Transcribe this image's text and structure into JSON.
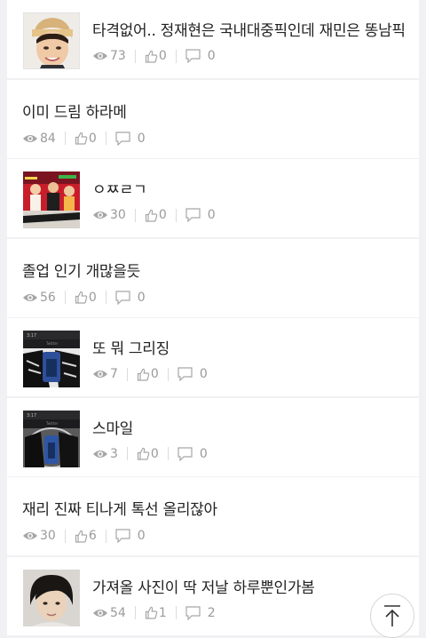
{
  "posts": [
    {
      "title": "타격없어.. 정재현은 국내대중픽인데 재민은 똥남픽",
      "views": "73",
      "likes": "0",
      "comments": "0",
      "thumb": "face-boy"
    },
    {
      "title": "이미 드림 하라메",
      "views": "84",
      "likes": "0",
      "comments": "0",
      "thumb": null
    },
    {
      "title": "ㅇㅉㄹㄱ",
      "views": "30",
      "likes": "0",
      "comments": "0",
      "thumb": "group-stage"
    },
    {
      "title": "졸업 인기 개많을듯",
      "views": "56",
      "likes": "0",
      "comments": "0",
      "thumb": null
    },
    {
      "title": "또 뭐 그리징",
      "views": "7",
      "likes": "0",
      "comments": "0",
      "thumb": "phone-screen"
    },
    {
      "title": "스마일",
      "views": "3",
      "likes": "0",
      "comments": "0",
      "thumb": "phone-screen"
    },
    {
      "title": "재리 진짜 티나게 톡선 올리잖아",
      "views": "30",
      "likes": "6",
      "comments": "0",
      "thumb": null
    },
    {
      "title": "가져올 사진이 딱 저날 하루뿐인가봄",
      "views": "54",
      "likes": "1",
      "comments": "2",
      "thumb": "face-portrait"
    }
  ],
  "icons": {
    "views": "eye-icon",
    "likes": "thumbs-up-icon",
    "comments": "comment-icon",
    "top": "arrow-up-icon"
  }
}
